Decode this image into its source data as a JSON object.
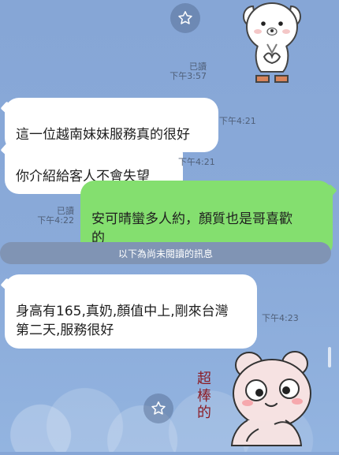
{
  "chat": {
    "messages": [
      {
        "side": "incoming",
        "text": "這一位越南妹妹服務真的很好",
        "time": "下午4:21"
      },
      {
        "side": "incoming",
        "text": "你介紹給客人不會失望",
        "time": "下午4:21"
      },
      {
        "side": "outgoing",
        "status": "已讀",
        "text": "安可晴蠻多人約，顏質也是哥喜歡\n的",
        "time": "下午4:22"
      },
      {
        "side": "incoming",
        "text": "身高有165,真奶,顏值中上,剛來台灣\n第二天,服務很好",
        "time": "下午4:23"
      }
    ],
    "top_status": "已讀",
    "top_time": "下午3:57",
    "unread_divider": "以下為尚未閱讀的訊息",
    "sticker_text": "超\n棒\n的"
  },
  "icons": {
    "favorite_top": "star-icon",
    "favorite_bottom": "star-icon"
  },
  "colors": {
    "background": "#86a6d6",
    "incoming_bubble": "#ffffff",
    "outgoing_bubble": "#84df6f",
    "divider": "#8094b4",
    "meta_text": "#4f5f78"
  }
}
